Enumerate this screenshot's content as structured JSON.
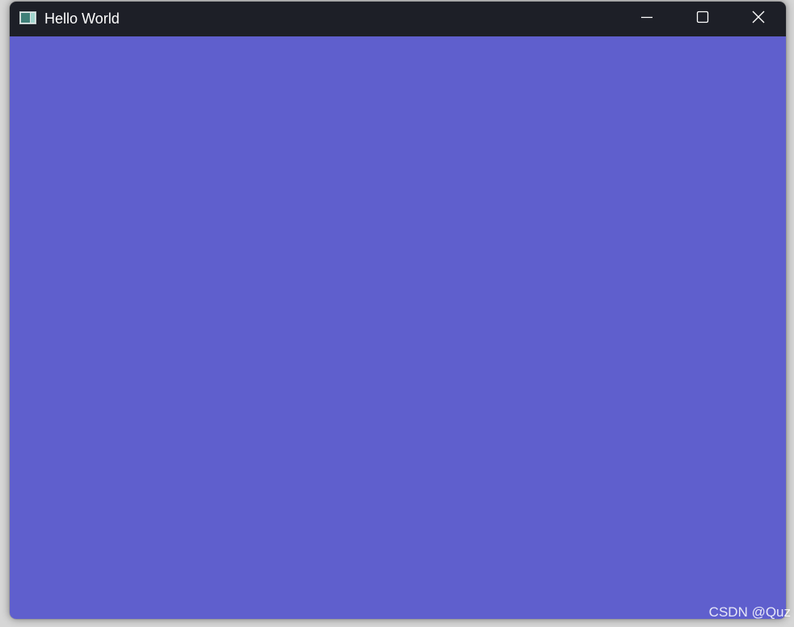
{
  "window": {
    "title": "Hello World",
    "icon": "app-window-icon",
    "controls": {
      "minimize_icon": "minimize-icon",
      "maximize_icon": "maximize-icon",
      "close_icon": "close-icon"
    },
    "colors": {
      "titlebar": "#1d1f27",
      "client_area": "#5f5fcd",
      "title_text": "#ffffff"
    }
  },
  "watermark": {
    "text": "CSDN @Quz"
  }
}
